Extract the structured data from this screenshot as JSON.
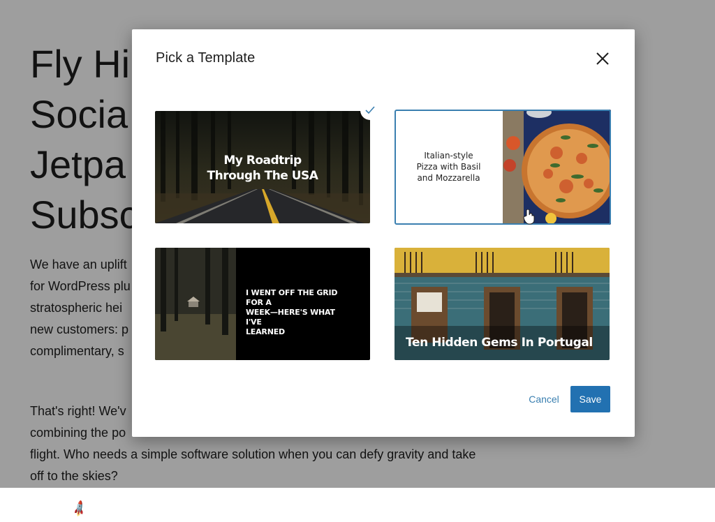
{
  "page": {
    "hero_lines": [
      "Fly Hi",
      "Socia",
      "Jetpa",
      "Subsc"
    ],
    "para1_lines": [
      "We have an uplift",
      "for WordPress plu",
      "stratospheric hei",
      "new customers: p",
      "complimentary, s"
    ],
    "para2_lines": [
      "That's right! We'v",
      "combining the po",
      "flight. Who needs a simple software solution when you can defy gravity and take",
      "off to the skies?"
    ]
  },
  "modal": {
    "title": "Pick a Template",
    "close_icon": "close-icon",
    "cancel_label": "Cancel",
    "save_label": "Save",
    "accent_color": "#2271b1"
  },
  "templates": [
    {
      "lines": [
        "My Roadtrip",
        "Through The USA"
      ],
      "selected": false,
      "checked": true
    },
    {
      "lines": [
        "Italian-style",
        "Pizza with Basil",
        "and Mozzarella"
      ],
      "selected": true,
      "checked": false
    },
    {
      "lines": [
        "I WENT OFF THE GRID FOR A",
        "WEEK—HERE'S WHAT I'VE",
        "LEARNED"
      ],
      "selected": false,
      "checked": false
    },
    {
      "lines": [
        "Ten Hidden Gems In Portugal"
      ],
      "selected": false,
      "checked": false
    }
  ]
}
